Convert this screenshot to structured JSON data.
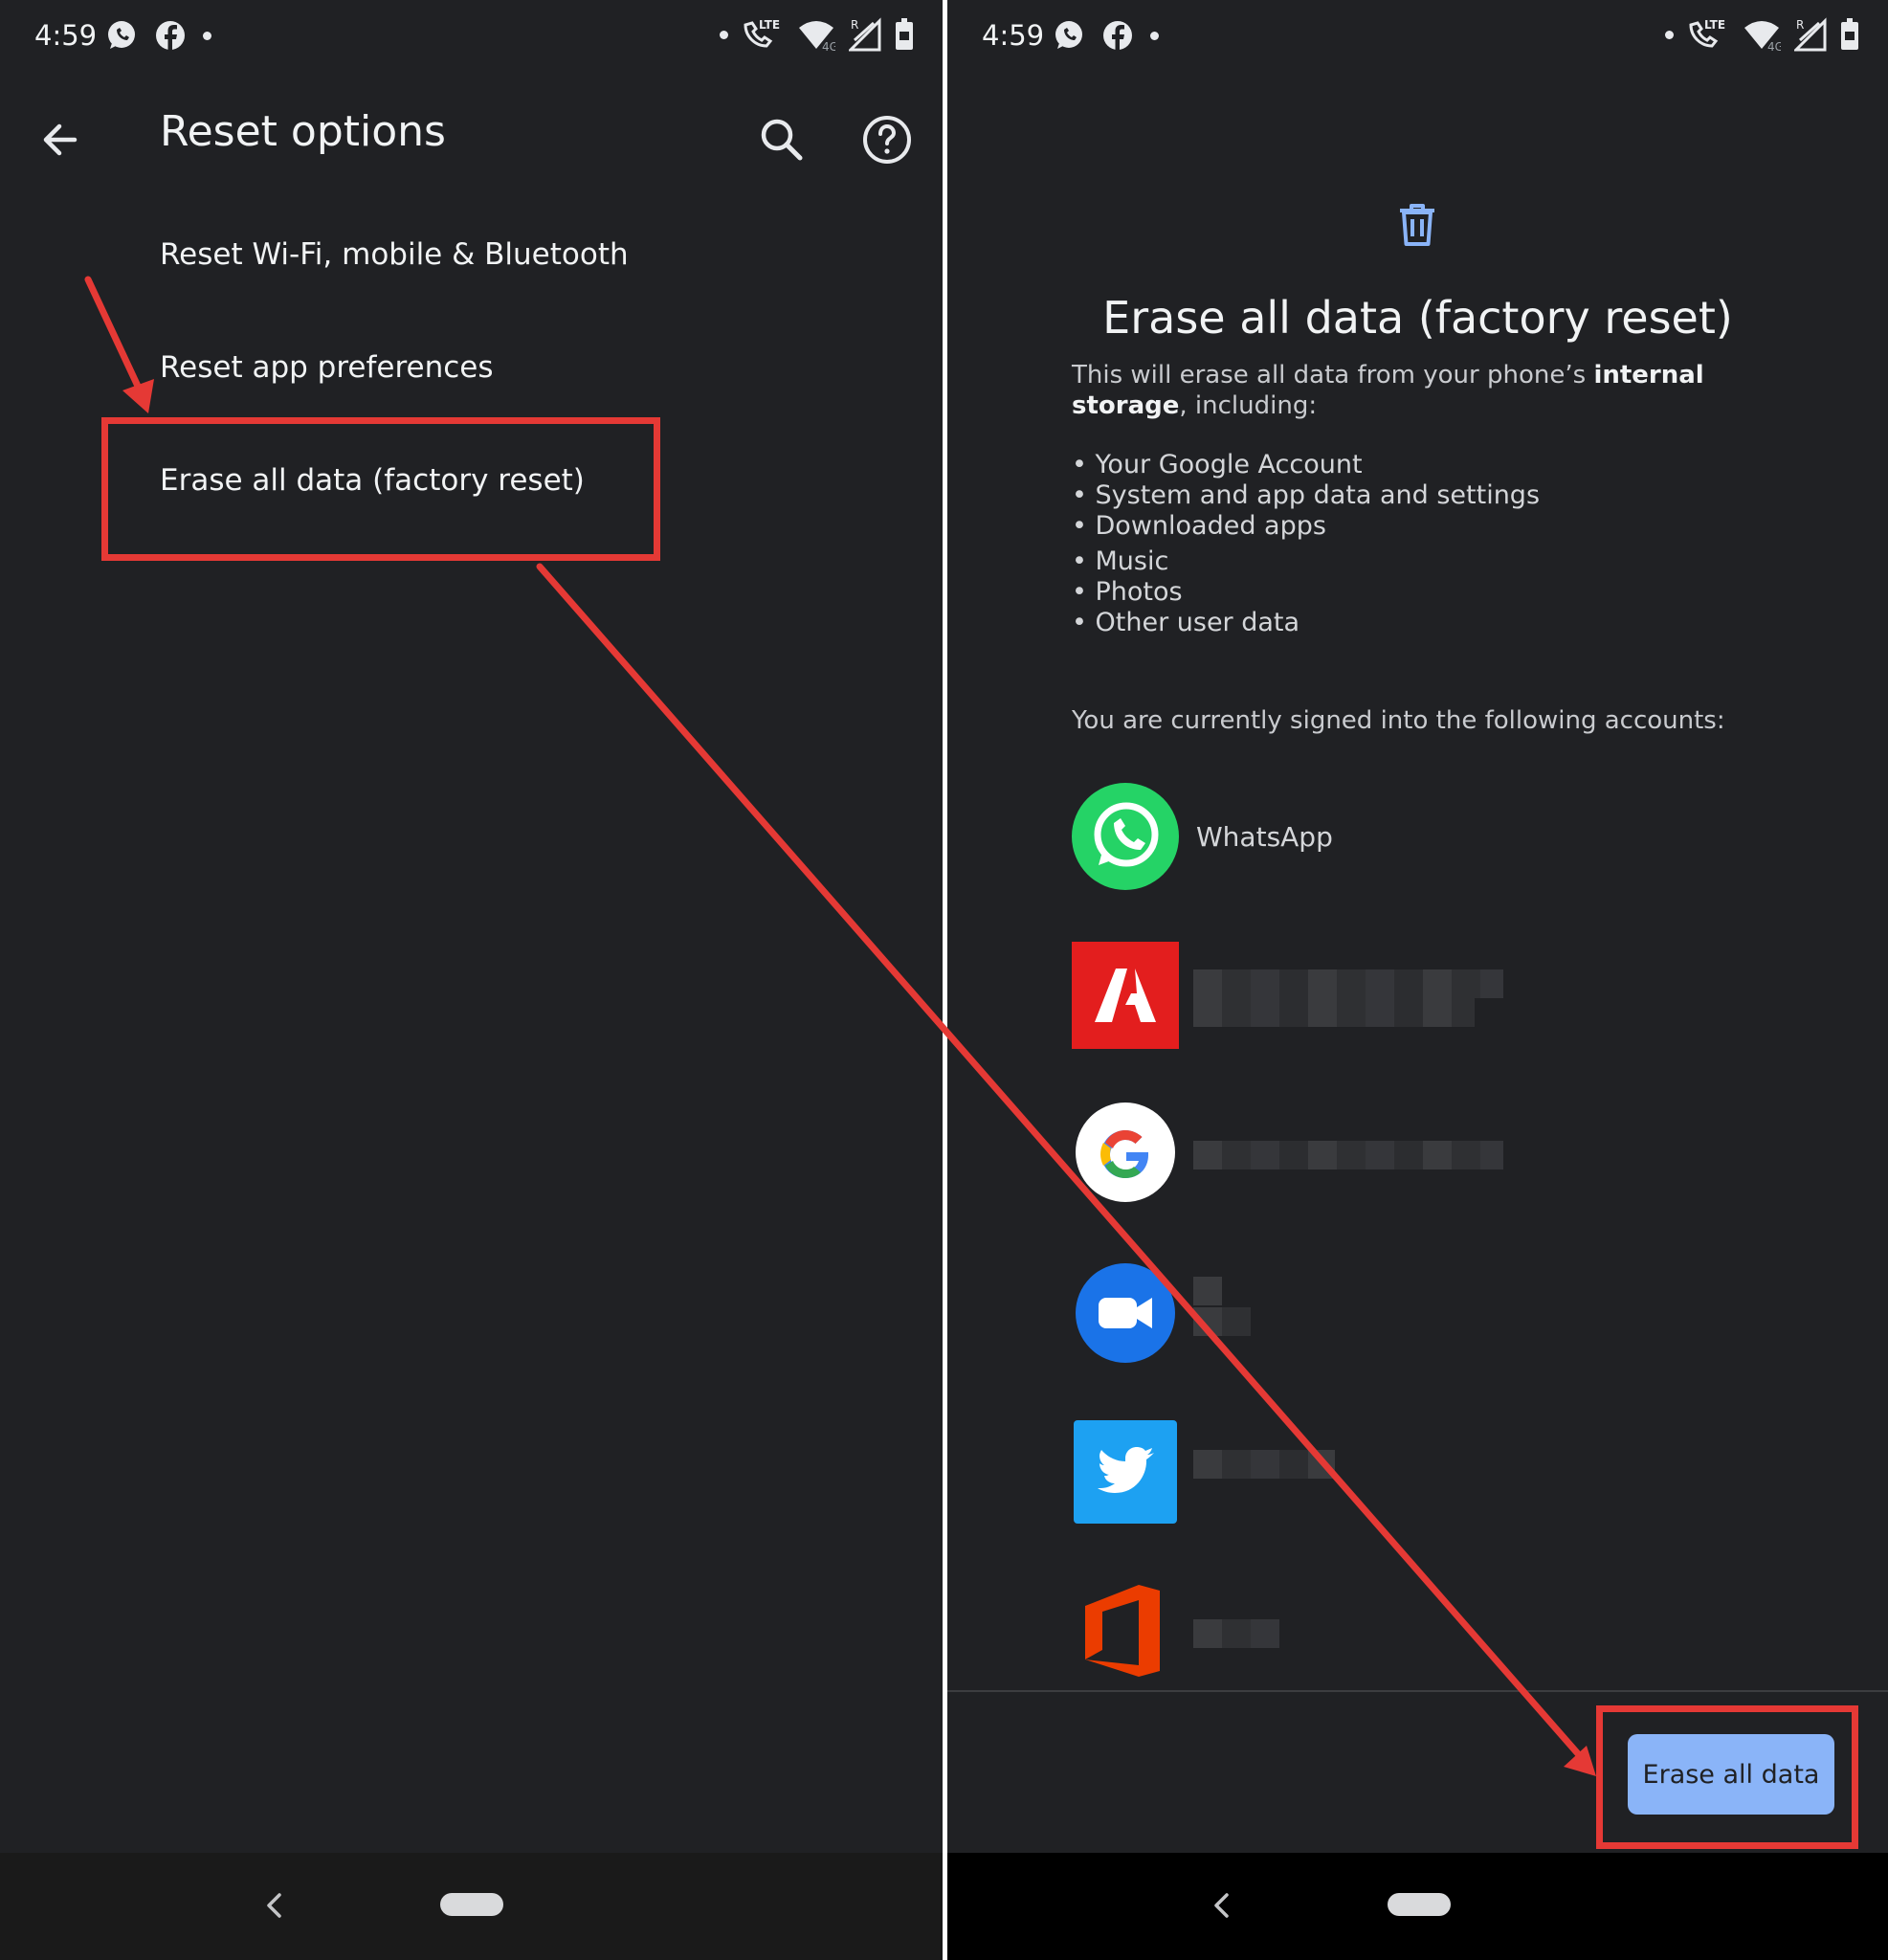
{
  "status_bar": {
    "time": "4:59",
    "network_label": "LTE",
    "signal_label": "4G",
    "roaming_label": "R"
  },
  "left_screen": {
    "title": "Reset options",
    "items": [
      {
        "label": "Reset Wi-Fi, mobile & Bluetooth"
      },
      {
        "label": "Reset app preferences"
      },
      {
        "label": "Erase all data (factory reset)"
      }
    ]
  },
  "right_screen": {
    "title": "Erase all data (factory reset)",
    "intro_prefix": "This will erase all data from your phone’s ",
    "intro_bold": "internal storage",
    "intro_suffix": ", including:",
    "bullets": [
      "Your Google Account",
      "System and app data and settings",
      "Downloaded apps",
      "Music",
      "Photos",
      "Other user data"
    ],
    "signed_in_text": "You are currently signed into the following accounts:",
    "accounts": [
      {
        "app": "whatsapp-icon",
        "label": "WhatsApp"
      },
      {
        "app": "adobe-icon",
        "label": ""
      },
      {
        "app": "google-icon",
        "label": ""
      },
      {
        "app": "duo-icon",
        "label": ""
      },
      {
        "app": "twitter-icon",
        "label": ""
      },
      {
        "app": "office-icon",
        "label": ""
      }
    ],
    "button_label": "Erase all data"
  },
  "colors": {
    "background": "#202124",
    "accent": "#8ab4f8",
    "highlight": "#e53935"
  }
}
